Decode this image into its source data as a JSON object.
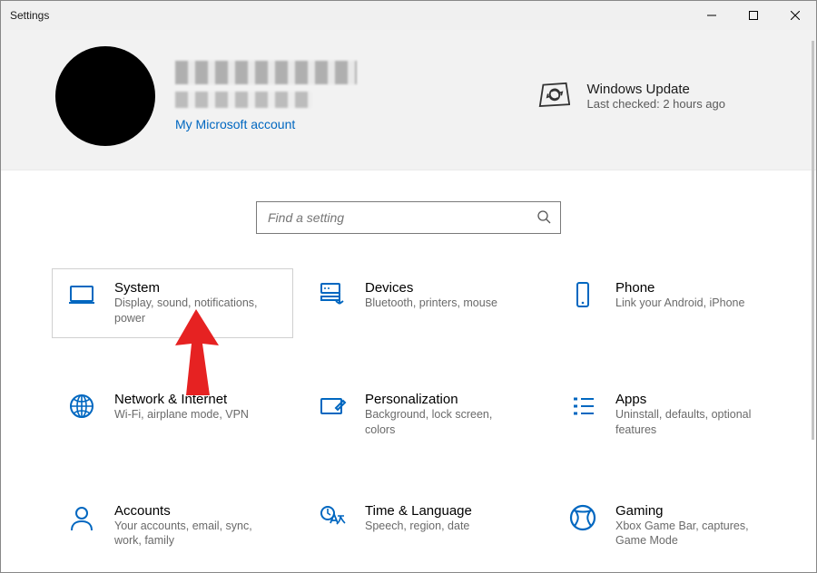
{
  "window": {
    "title": "Settings"
  },
  "header": {
    "ms_account_link": "My Microsoft account",
    "update": {
      "title": "Windows Update",
      "subtitle": "Last checked: 2 hours ago"
    }
  },
  "search": {
    "placeholder": "Find a setting"
  },
  "tiles": {
    "system": {
      "title": "System",
      "desc": "Display, sound, notifications, power"
    },
    "devices": {
      "title": "Devices",
      "desc": "Bluetooth, printers, mouse"
    },
    "phone": {
      "title": "Phone",
      "desc": "Link your Android, iPhone"
    },
    "network": {
      "title": "Network & Internet",
      "desc": "Wi-Fi, airplane mode, VPN"
    },
    "personal": {
      "title": "Personalization",
      "desc": "Background, lock screen, colors"
    },
    "apps": {
      "title": "Apps",
      "desc": "Uninstall, defaults, optional features"
    },
    "accounts": {
      "title": "Accounts",
      "desc": "Your accounts, email, sync, work, family"
    },
    "timelang": {
      "title": "Time & Language",
      "desc": "Speech, region, date"
    },
    "gaming": {
      "title": "Gaming",
      "desc": "Xbox Game Bar, captures, Game Mode"
    }
  }
}
